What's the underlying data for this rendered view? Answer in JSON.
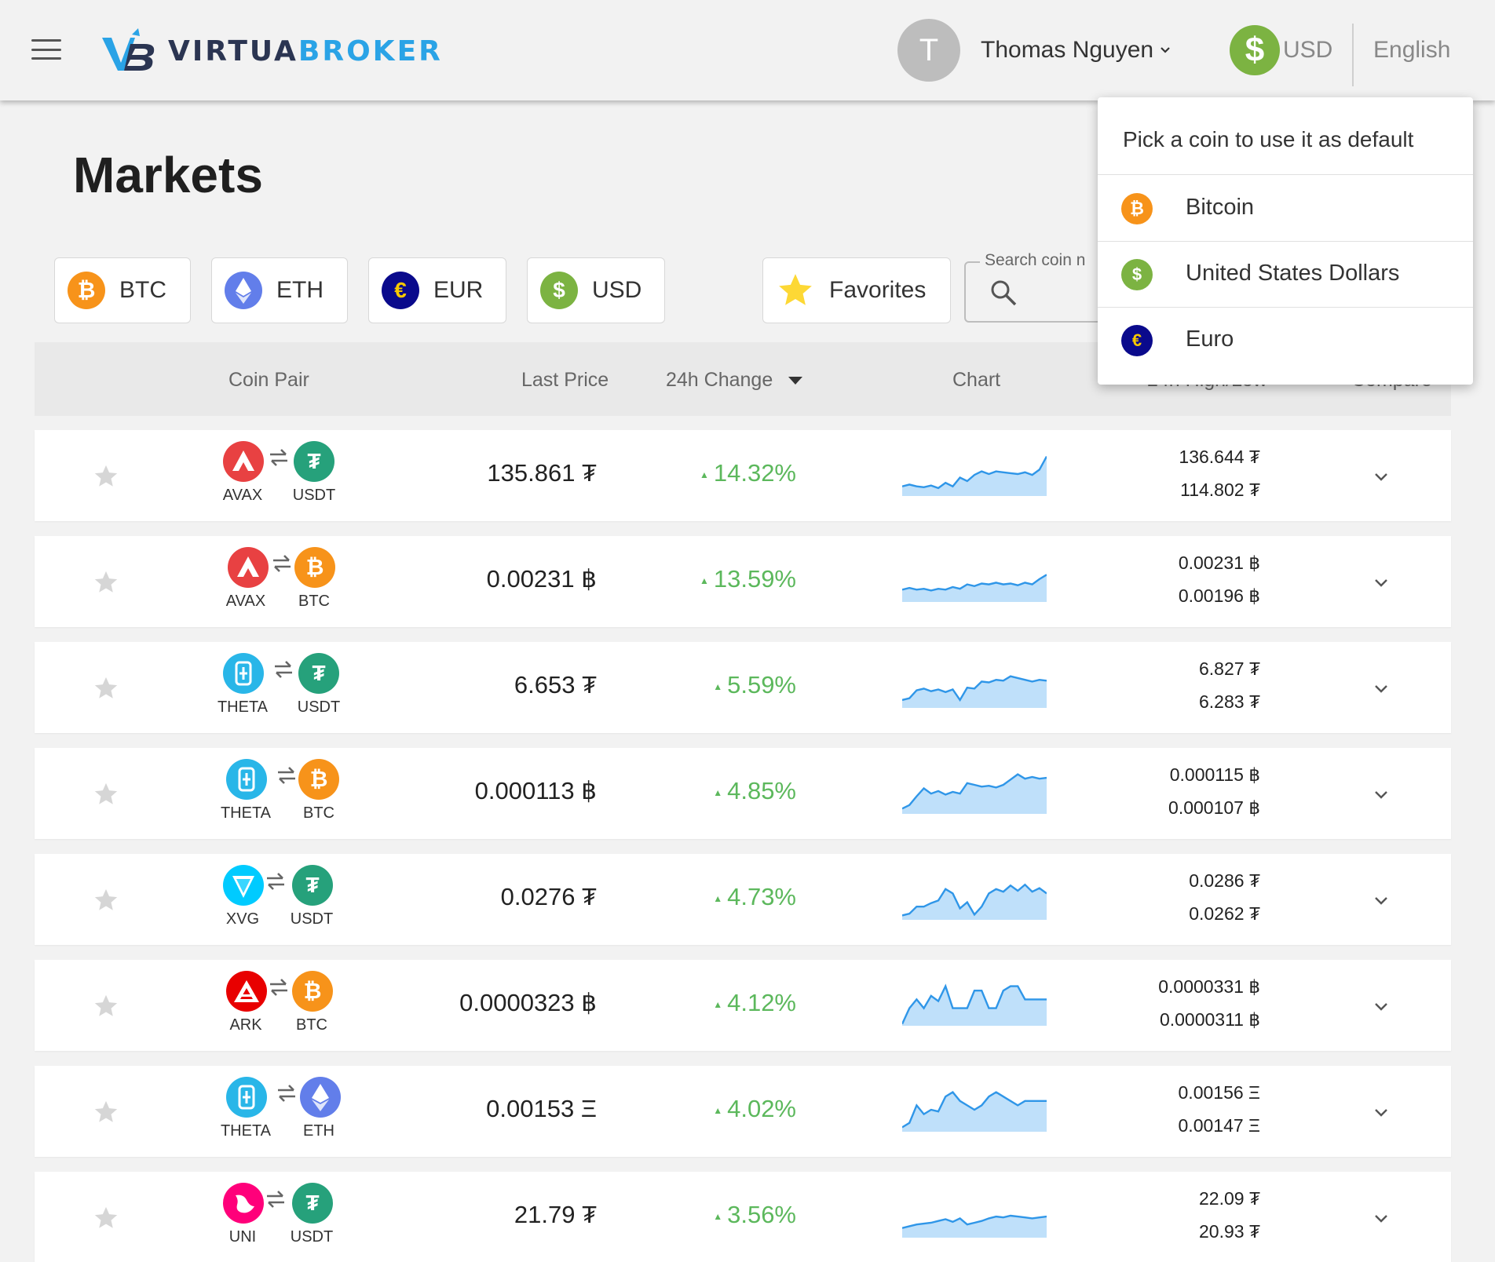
{
  "header": {
    "user_initial": "T",
    "user_name": "Thomas Nguyen",
    "currency_symbol": "$",
    "currency_label": "USD",
    "language": "English"
  },
  "page": {
    "title": "Markets"
  },
  "filters": [
    {
      "label": "BTC",
      "icon": "bitcoin-icon",
      "color": "#f7931a",
      "glyph": "₿"
    },
    {
      "label": "ETH",
      "icon": "ethereum-icon",
      "color": "#627eea",
      "glyph": "◆"
    },
    {
      "label": "EUR",
      "icon": "euro-icon",
      "color": "#0a0a8c",
      "glyph": "€"
    },
    {
      "label": "USD",
      "icon": "dollar-icon",
      "color": "#7cb342",
      "glyph": "$"
    },
    {
      "label": "Favorites",
      "icon": "star-icon",
      "color": "#fdd835",
      "glyph": "★"
    }
  ],
  "search": {
    "placeholder": "Search coin n"
  },
  "table": {
    "headers": {
      "pair": "Coin Pair",
      "last_price": "Last Price",
      "change": "24h Change",
      "chart": "Chart",
      "high_low": "24h High/Low",
      "compare": "Compare"
    },
    "rows": [
      {
        "base": "AVAX",
        "quote": "USDT",
        "price": "135.861 ₮",
        "change": "14.32%",
        "high": "136.644 ₮",
        "low": "114.802 ₮"
      },
      {
        "base": "AVAX",
        "quote": "BTC",
        "price": "0.00231 ฿",
        "change": "13.59%",
        "high": "0.00231 ฿",
        "low": "0.00196 ฿"
      },
      {
        "base": "THETA",
        "quote": "USDT",
        "price": "6.653 ₮",
        "change": "5.59%",
        "high": "6.827 ₮",
        "low": "6.283 ₮"
      },
      {
        "base": "THETA",
        "quote": "BTC",
        "price": "0.000113 ฿",
        "change": "4.85%",
        "high": "0.000115 ฿",
        "low": "0.000107 ฿"
      },
      {
        "base": "XVG",
        "quote": "USDT",
        "price": "0.0276 ₮",
        "change": "4.73%",
        "high": "0.0286 ₮",
        "low": "0.0262 ₮"
      },
      {
        "base": "ARK",
        "quote": "BTC",
        "price": "0.0000323 ฿",
        "change": "4.12%",
        "high": "0.0000331 ฿",
        "low": "0.0000311 ฿"
      },
      {
        "base": "THETA",
        "quote": "ETH",
        "price": "0.00153 Ξ",
        "change": "4.02%",
        "high": "0.00156 Ξ",
        "low": "0.00147 Ξ"
      },
      {
        "base": "UNI",
        "quote": "USDT",
        "price": "21.79 ₮",
        "change": "3.56%",
        "high": "22.09 ₮",
        "low": "20.93 ₮"
      }
    ]
  },
  "dropdown": {
    "title": "Pick a coin to use it as default",
    "items": [
      {
        "label": "Bitcoin",
        "icon": "bitcoin-icon",
        "color": "#f7931a",
        "glyph": "₿"
      },
      {
        "label": "United States Dollars",
        "icon": "dollar-icon",
        "color": "#7cb342",
        "glyph": "$"
      },
      {
        "label": "Euro",
        "icon": "euro-icon",
        "color": "#0a0a8c",
        "glyph": "€"
      }
    ]
  },
  "colors": {
    "positive": "#5cb85c",
    "spark_line": "#2f96e8",
    "spark_fill": "#bfe0fa",
    "brand_blue": "#2aa3e6",
    "brand_dark": "#2b3552"
  }
}
